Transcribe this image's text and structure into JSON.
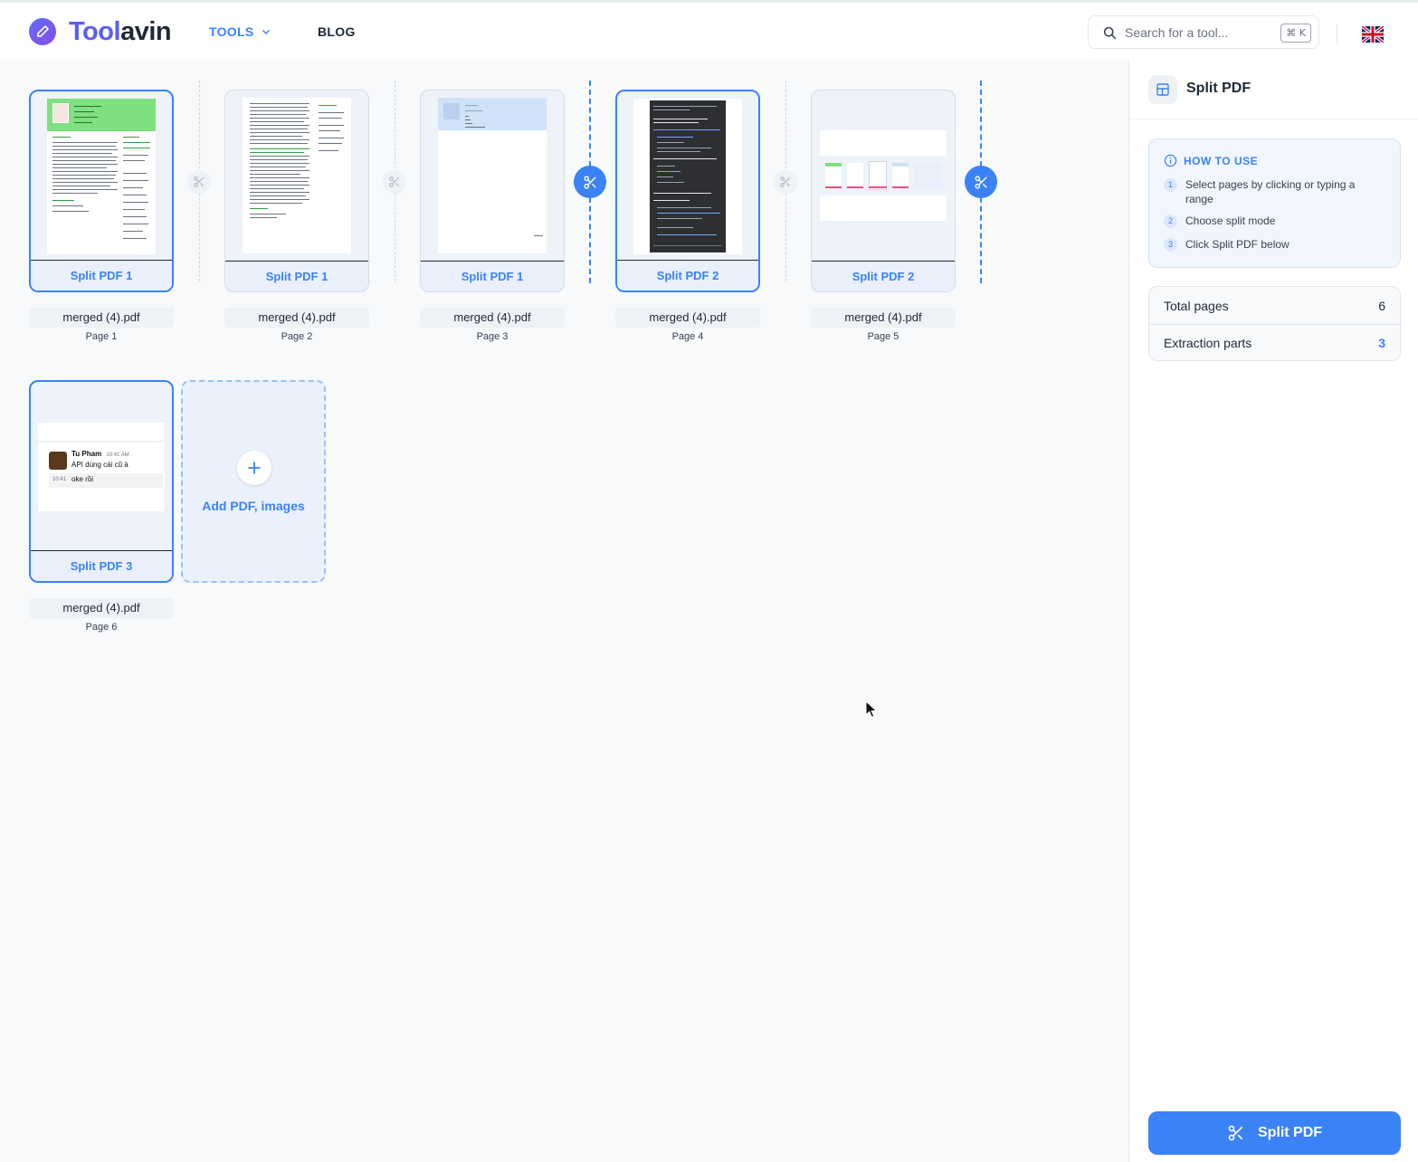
{
  "header": {
    "brand_part1": "Tool",
    "brand_part2": "avin",
    "nav_tools": "TOOLS",
    "nav_blog": "BLOG",
    "search_placeholder": "Search for a tool...",
    "search_shortcut": "⌘ K",
    "language_flag": "uk-flag-icon"
  },
  "pages": [
    {
      "part_label": "Split PDF 1",
      "filename": "merged (4).pdf",
      "page_label": "Page 1",
      "selected": true
    },
    {
      "part_label": "Split PDF 1",
      "filename": "merged (4).pdf",
      "page_label": "Page 2",
      "selected": false
    },
    {
      "part_label": "Split PDF 1",
      "filename": "merged (4).pdf",
      "page_label": "Page 3",
      "selected": false
    },
    {
      "part_label": "Split PDF 2",
      "filename": "merged (4).pdf",
      "page_label": "Page 4",
      "selected": true
    },
    {
      "part_label": "Split PDF 2",
      "filename": "merged (4).pdf",
      "page_label": "Page 5",
      "selected": false
    },
    {
      "part_label": "Split PDF 3",
      "filename": "merged (4).pdf",
      "page_label": "Page 6",
      "selected": true
    }
  ],
  "split_points_active": [
    3,
    5
  ],
  "thumb_text": {
    "chat_name": "Tu Pham",
    "chat_time": "10:41 AM",
    "chat_msg1": "API dùng cái cũ à",
    "chat_time2": "10:41",
    "chat_msg2": "oke rồi"
  },
  "add_card": {
    "label": "Add PDF, images"
  },
  "sidebar": {
    "title": "Split PDF",
    "howto_title": "HOW TO USE",
    "steps": [
      {
        "num": "1",
        "text": "Select pages by clicking or typing a range"
      },
      {
        "num": "2",
        "text": "Choose split mode"
      },
      {
        "num": "3",
        "text": "Click Split PDF below"
      }
    ],
    "stats": [
      {
        "label": "Total pages",
        "value": "6"
      },
      {
        "label": "Extraction parts",
        "value": "3"
      }
    ],
    "action_label": "Split PDF"
  },
  "colors": {
    "accent": "#3b82f6",
    "brand": "#5a5ff0"
  }
}
